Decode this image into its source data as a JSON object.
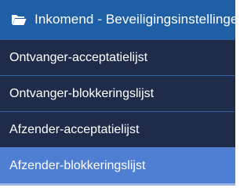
{
  "menu": {
    "header": {
      "icon": "folder-open-icon",
      "label": "Inkomend - Beveiligingsinstellingen"
    },
    "items": [
      {
        "label": "Ontvanger-acceptatielijst",
        "active": false
      },
      {
        "label": "Ontvanger-blokkeringslijst",
        "active": false
      },
      {
        "label": "Afzender-acceptatielijst",
        "active": false
      },
      {
        "label": "Afzender-blokkeringslijst",
        "active": true
      }
    ]
  },
  "colors": {
    "header_bg": "#1f5fa6",
    "item_bg": "#1e2c4a",
    "active_bg": "#4f7fd3"
  }
}
